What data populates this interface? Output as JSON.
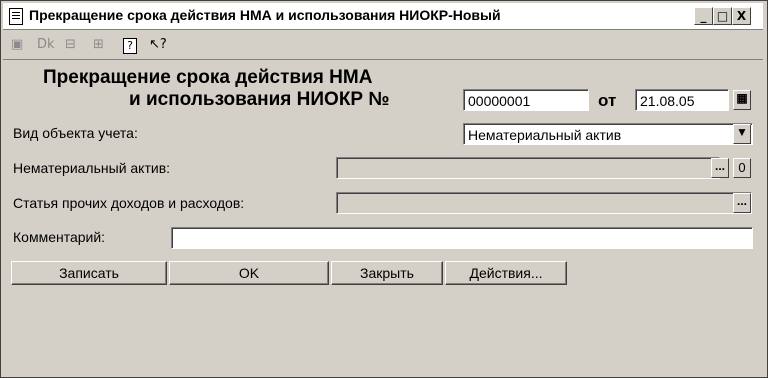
{
  "window": {
    "title": "Прекращение срока действия НМА и использования НИОКР-Новый",
    "minimize": "_",
    "maximize": "□",
    "close": "X"
  },
  "toolbar": {
    "icons": [
      "copy-document-icon",
      "delete-document-icon",
      "structure-icon",
      "table-icon",
      "help-icon",
      "whats-this-icon"
    ]
  },
  "form": {
    "heading_line1": "Прекращение срока действия НМА",
    "heading_line2": "и использования НИОКР №",
    "doc_number": "00000001",
    "date_label": "от",
    "date_value": "21.08.05",
    "object_type_label": "Вид объекта учета:",
    "object_type_value": "Нематериальный актив",
    "intangible_asset_label": "Нематериальный актив:",
    "intangible_asset_value": "",
    "clear_button": "0",
    "expense_item_label": "Статья прочих доходов и расходов:",
    "expense_item_value": "",
    "comment_label": "Комментарий:",
    "comment_value": "",
    "select_button": "...",
    "dropdown_arrow": "▼"
  },
  "buttons": {
    "save": "Записать",
    "ok": "OK",
    "close": "Закрыть",
    "actions": "Действия..."
  }
}
